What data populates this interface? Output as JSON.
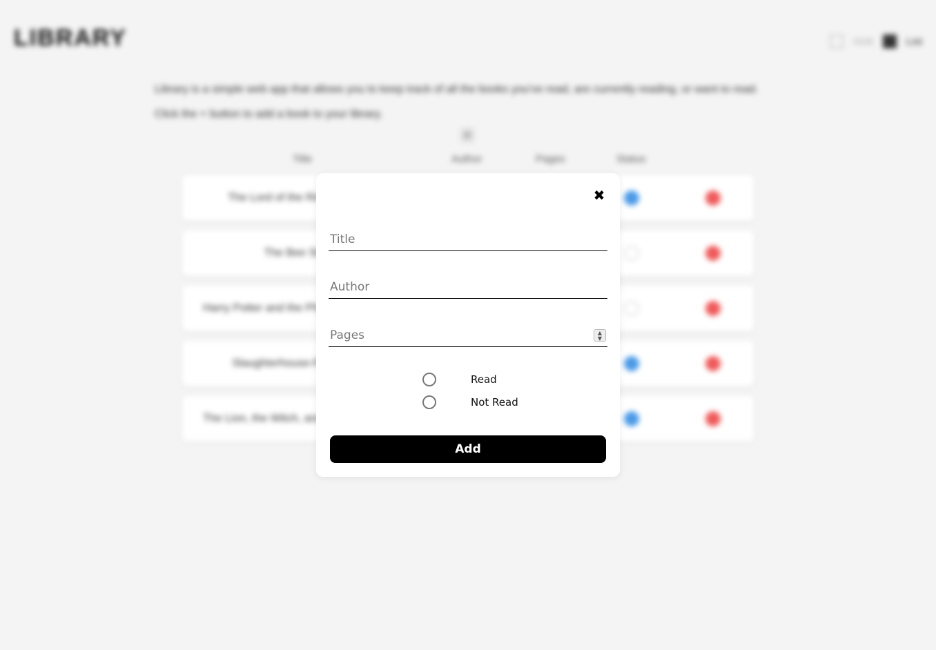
{
  "background": {
    "logo": "LIBRARY",
    "view_toggle": {
      "grid_label": "Grid",
      "list_label": "List"
    },
    "intro": [
      "Library is a simple web app that allows you to keep track of all the books you've read, are currently reading, or want to read.",
      "Click the + button to add a book to your library."
    ],
    "add_symbol": "+",
    "columns": [
      "Title",
      "Author",
      "Pages",
      "Status"
    ],
    "rows": [
      {
        "title": "The Lord of the Rings",
        "status": "read"
      },
      {
        "title": "The Bee Sting",
        "status": "unread"
      },
      {
        "title": "Harry Potter and the Philosopher's Stone",
        "status": "unread"
      },
      {
        "title": "Slaughterhouse-Five",
        "status": "read"
      },
      {
        "title": "The Lion, the Witch, and the Wardrobe",
        "status": "read"
      }
    ],
    "colors": {
      "read": "#4a9ae8",
      "delete": "#f05a5a"
    }
  },
  "modal": {
    "close_glyph": "✖",
    "fields": {
      "title_placeholder": "Title",
      "author_placeholder": "Author",
      "pages_placeholder": "Pages"
    },
    "radios": {
      "read_label": "Read",
      "not_read_label": "Not Read"
    },
    "submit_label": "Add"
  }
}
